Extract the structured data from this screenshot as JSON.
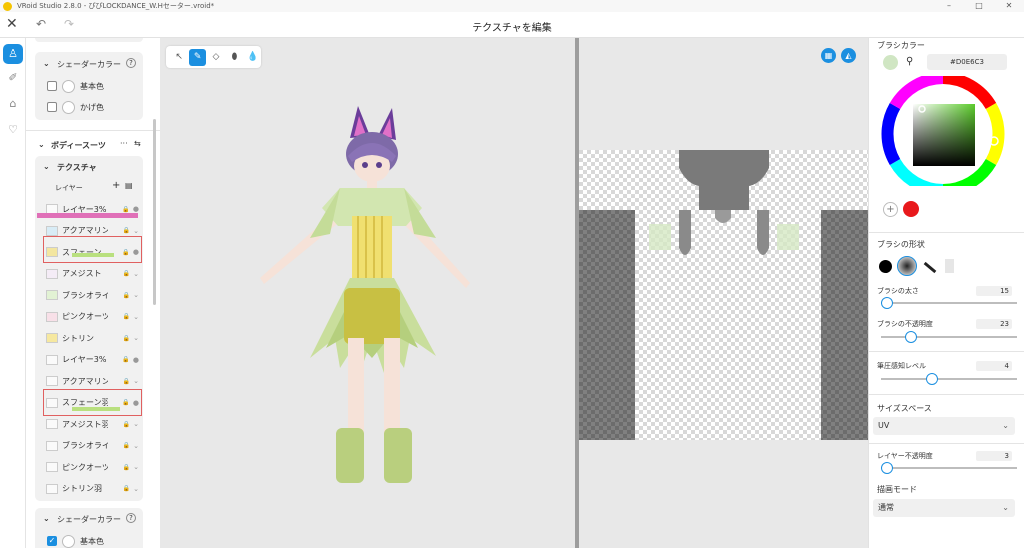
{
  "window": {
    "title": "VRoid Studio 2.8.0 - ぴぴLOCKDANCE_W.Hセーター.vroid*",
    "controls": [
      "–",
      "□",
      "✕"
    ]
  },
  "toolbar": {
    "title": "テクスチャを編集",
    "close": "✕",
    "undo": "↶",
    "redo": "↷"
  },
  "rail": {
    "items": [
      {
        "name": "avatar-icon",
        "glyph": "♙"
      },
      {
        "name": "brush-icon",
        "glyph": "✐"
      },
      {
        "name": "outfit-icon",
        "glyph": "⌂"
      },
      {
        "name": "heart-icon",
        "glyph": "♡"
      }
    ]
  },
  "left": {
    "shader1": {
      "title": "シェーダーカラー",
      "help": "?",
      "base": "基本色",
      "shade": "かげ色"
    },
    "bodysuit": {
      "title": "ボディースーツ",
      "more": "···",
      "settings": "⇆"
    },
    "texture": {
      "title": "テクスチャ",
      "layers_label": "レイヤー",
      "add": "+",
      "menu": "▤"
    },
    "layers": [
      {
        "name": "レイヤー3%",
        "icon": "●"
      },
      {
        "name": "アクアマリン",
        "icon": "⌄"
      },
      {
        "name": "スフェーン",
        "icon": "●"
      },
      {
        "name": "アメジスト",
        "icon": "⌄"
      },
      {
        "name": "ブラシオライト",
        "icon": "⌄"
      },
      {
        "name": "ピンクオーツ",
        "icon": "⌄"
      },
      {
        "name": "シトリン",
        "icon": "⌄"
      },
      {
        "name": "レイヤー3%",
        "icon": "●"
      },
      {
        "name": "アクアマリン",
        "icon": "⌄"
      },
      {
        "name": "スフェーン羽",
        "icon": "●"
      },
      {
        "name": "アメジスト羽",
        "icon": "⌄"
      },
      {
        "name": "ブラシオライト羽",
        "icon": "⌄"
      },
      {
        "name": "ピンクオーツ羽",
        "icon": "⌄"
      },
      {
        "name": "シトリン羽",
        "icon": "⌄"
      }
    ],
    "shader2": {
      "title": "シェーダーカラー",
      "help": "?",
      "base": "基本色",
      "check": "✓"
    }
  },
  "tools": [
    "↖",
    "✎",
    "◇",
    "⬮",
    "💧"
  ],
  "uv_buttons": [
    "▦",
    "◭"
  ],
  "right": {
    "brush_color": {
      "label": "ブラシカラー",
      "hex": "#D0E6C3",
      "swatch": "#d0e6c3",
      "recent": "#e8191c",
      "add": "+",
      "picker": "⚲"
    },
    "brush_shape": {
      "label": "ブラシの形状"
    },
    "brush_size": {
      "label": "ブラシの太さ",
      "value": "15"
    },
    "brush_opacity": {
      "label": "ブラシの不透明度",
      "value": "23"
    },
    "pressure": {
      "label": "筆圧感知レベル",
      "value": "4"
    },
    "size_space": {
      "label": "サイズスペース",
      "value": "UV"
    },
    "layer_opacity": {
      "label": "レイヤー不透明度",
      "value": "3"
    },
    "blend_mode": {
      "label": "描画モード",
      "value": "通常"
    }
  }
}
